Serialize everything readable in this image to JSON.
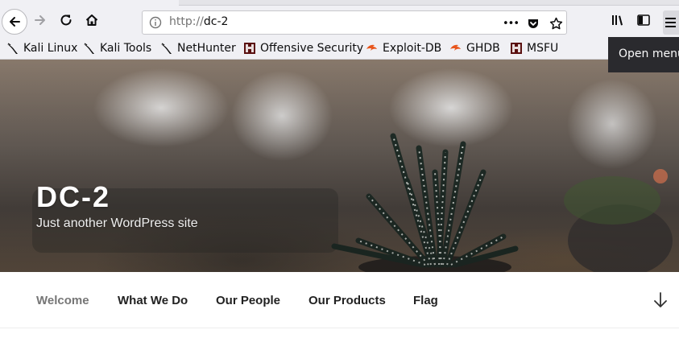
{
  "browser": {
    "url_scheme": "http://",
    "url_host": "dc-2",
    "page_actions_label": "•••",
    "menu_tooltip": "Open menu"
  },
  "bookmarks": [
    {
      "label": "Kali Linux",
      "icon": "kali-dragon-icon"
    },
    {
      "label": "Kali Tools",
      "icon": "kali-dragon-icon"
    },
    {
      "label": "NetHunter",
      "icon": "kali-dragon-icon"
    },
    {
      "label": "Offensive Security",
      "icon": "offsec-icon"
    },
    {
      "label": "Exploit-DB",
      "icon": "exploitdb-icon"
    },
    {
      "label": "GHDB",
      "icon": "exploitdb-icon"
    },
    {
      "label": "MSFU",
      "icon": "offsec-icon"
    }
  ],
  "site": {
    "title": "DC-2",
    "description": "Just another WordPress site"
  },
  "nav": {
    "items": [
      {
        "label": "Welcome",
        "current": true
      },
      {
        "label": "What We Do",
        "current": false
      },
      {
        "label": "Our People",
        "current": false
      },
      {
        "label": "Our Products",
        "current": false
      },
      {
        "label": "Flag",
        "current": false
      }
    ]
  },
  "colors": {
    "toolbar_bg": "#f0f0f4",
    "tooltip_bg": "#2a2a2e",
    "nav_current": "#767676",
    "nav_text": "#222222"
  }
}
